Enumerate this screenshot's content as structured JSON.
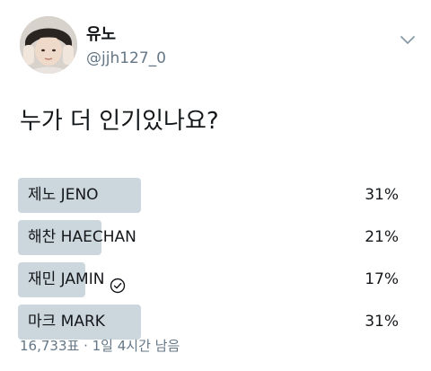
{
  "tweet": {
    "display_name": "유노",
    "handle": "@jjh127_0",
    "text": "누가 더 인기있나요?",
    "caret_icon": "chevron-down-icon",
    "avatar_icon": "avatar"
  },
  "poll": {
    "bar_color": "#ccd6dd",
    "options": [
      {
        "label": "제노 JENO",
        "percent_text": "31%",
        "fraction": 0.31,
        "selected": false
      },
      {
        "label": "해찬 HAECHAN",
        "percent_text": "21%",
        "fraction": 0.21,
        "selected": false
      },
      {
        "label": "재민 JAMIN",
        "percent_text": "17%",
        "fraction": 0.17,
        "selected": true
      },
      {
        "label": "마크 MARK",
        "percent_text": "31%",
        "fraction": 0.31,
        "selected": false
      }
    ],
    "votes_text": "16,733표",
    "separator": "·",
    "time_left_text": "1일 4시간 남음"
  }
}
